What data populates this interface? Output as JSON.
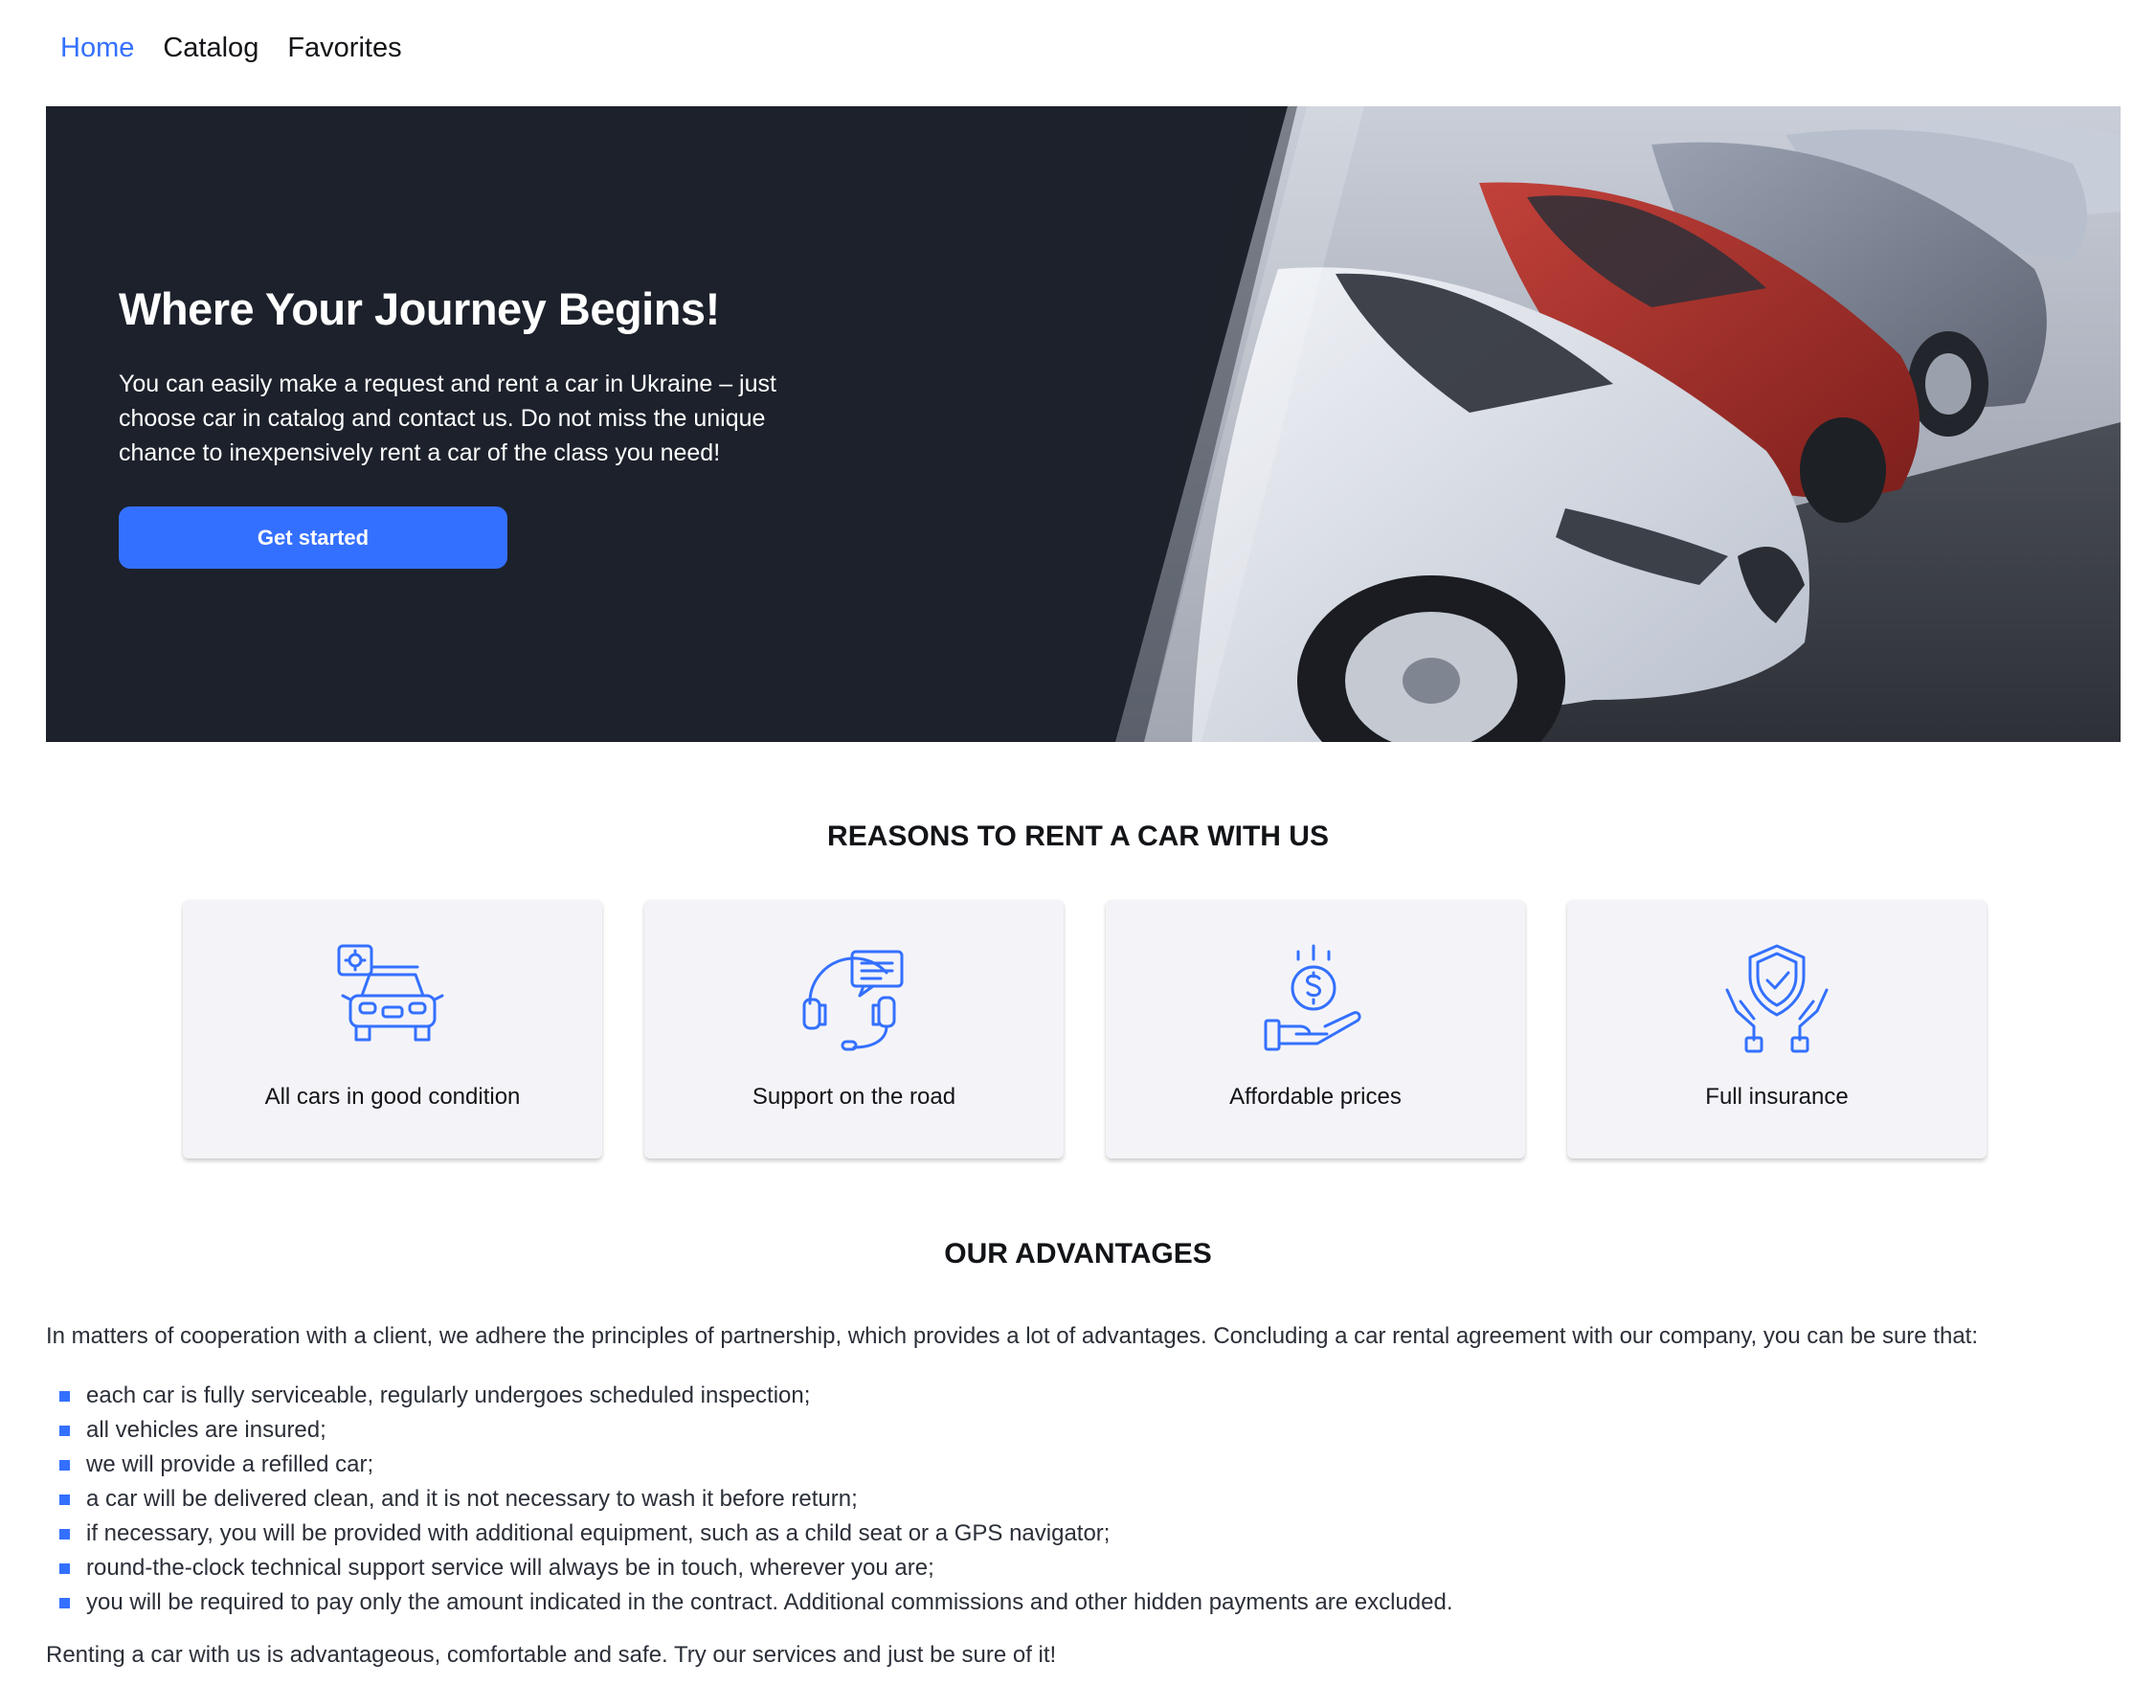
{
  "nav": {
    "items": [
      {
        "label": "Home",
        "active": true
      },
      {
        "label": "Catalog",
        "active": false
      },
      {
        "label": "Favorites",
        "active": false
      }
    ]
  },
  "hero": {
    "title": "Where Your Journey Begins!",
    "text": "You can easily make a request and rent a car in Ukraine – just choose car in catalog and contact us. Do not miss the unique chance to inexpensively rent a car of the class you need!",
    "button_label": "Get started",
    "image_icon": "parked-cars-photo"
  },
  "reasons": {
    "title": "REASONS TO RENT A CAR WITH US",
    "cards": [
      {
        "label": "All cars in good condition",
        "icon": "car-service-icon"
      },
      {
        "label": "Support on the road",
        "icon": "headset-support-icon"
      },
      {
        "label": "Affordable prices",
        "icon": "coin-hand-icon"
      },
      {
        "label": "Full insurance",
        "icon": "shield-hands-icon"
      }
    ]
  },
  "advantages": {
    "title": "OUR ADVANTAGES",
    "intro": "In matters of cooperation with a client, we adhere the principles of partnership, which provides a lot of advantages. Concluding a car rental agreement with our company, you can be sure that:",
    "items": [
      "each car is fully serviceable, regularly undergoes scheduled inspection;",
      "all vehicles are insured;",
      "we will provide a refilled car;",
      "a car will be delivered clean, and it is not necessary to wash it before return;",
      "if necessary, you will be provided with additional equipment, such as a child seat or a GPS navigator;",
      "round-the-clock technical support service will always be in touch, wherever you are;",
      "you will be required to pay only the amount indicated in the contract. Additional commissions and other hidden payments are excluded."
    ],
    "outro": "Renting a car with us is advantageous, comfortable and safe. Try our services and just be sure of it!"
  },
  "colors": {
    "accent": "#3470ff",
    "hero_bg": "#1c212b",
    "card_bg": "#f4f4f8",
    "text": "#121417"
  }
}
